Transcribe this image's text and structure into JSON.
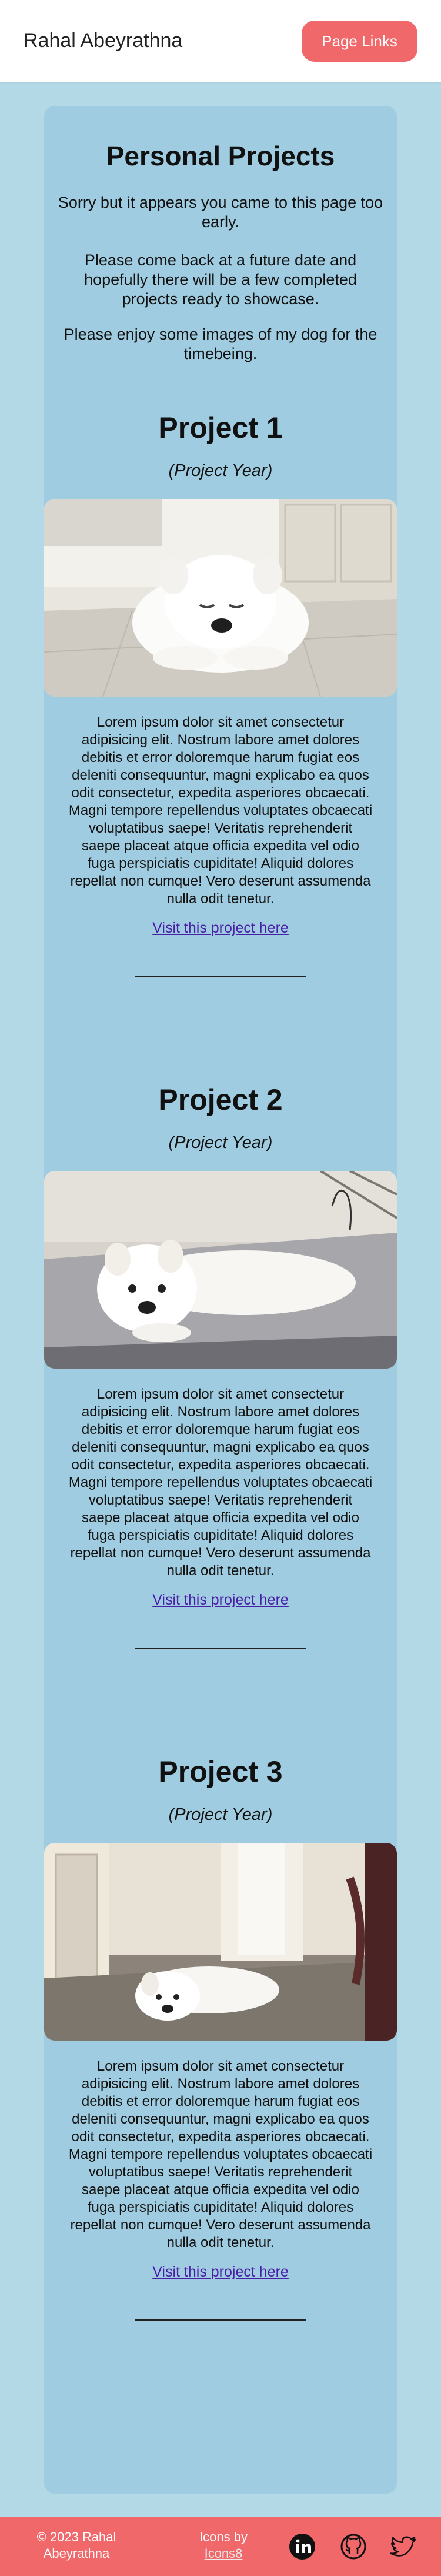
{
  "header": {
    "brand": "Rahal Abeyrathna",
    "nav_button": "Page Links"
  },
  "main": {
    "title": "Personal Projects",
    "intro": [
      "Sorry but it appears you came to this page too early.",
      "Please come back at a future date and hopefully there will be a few completed projects ready to showcase.",
      "Please enjoy some images of my dog for the timebeing."
    ],
    "projects": [
      {
        "title": "Project 1",
        "year": "(Project Year)",
        "description": "Lorem ipsum dolor sit amet consectetur adipisicing elit. Nostrum labore amet dolores debitis et error doloremque harum fugiat eos deleniti consequuntur, magni explicabo ea quos odit consectetur, expedita asperiores obcaecati. Magni tempore repellendus voluptates obcaecati voluptatibus saepe! Veritatis reprehenderit saepe placeat atque officia expedita vel odio fuga perspiciatis cupiditate! Aliquid dolores repellat non cumque! Vero deserunt assumenda nulla odit tenetur.",
        "link": "Visit this project here"
      },
      {
        "title": "Project 2",
        "year": "(Project Year)",
        "description": "Lorem ipsum dolor sit amet consectetur adipisicing elit. Nostrum labore amet dolores debitis et error doloremque harum fugiat eos deleniti consequuntur, magni explicabo ea quos odit consectetur, expedita asperiores obcaecati. Magni tempore repellendus voluptates obcaecati voluptatibus saepe! Veritatis reprehenderit saepe placeat atque officia expedita vel odio fuga perspiciatis cupiditate! Aliquid dolores repellat non cumque! Vero deserunt assumenda nulla odit tenetur.",
        "link": "Visit this project here"
      },
      {
        "title": "Project 3",
        "year": "(Project Year)",
        "description": "Lorem ipsum dolor sit amet consectetur adipisicing elit. Nostrum labore amet dolores debitis et error doloremque harum fugiat eos deleniti consequuntur, magni explicabo ea quos odit consectetur, expedita asperiores obcaecati. Magni tempore repellendus voluptates obcaecati voluptatibus saepe! Veritatis reprehenderit saepe placeat atque officia expedita vel odio fuga perspiciatis cupiditate! Aliquid dolores repellat non cumque! Vero deserunt assumenda nulla odit tenetur.",
        "link": "Visit this project here"
      }
    ]
  },
  "footer": {
    "copyright": "© 2023 Rahal Abeyrathna",
    "credit_prefix": "Icons by",
    "credit_link": "Icons8",
    "social": [
      "linkedin-icon",
      "github-icon",
      "twitter-icon"
    ]
  },
  "colors": {
    "accent": "#f0686a",
    "page_background": "#b3d9e6",
    "card_background": "#9fcce0",
    "link": "#4a1fa8"
  }
}
